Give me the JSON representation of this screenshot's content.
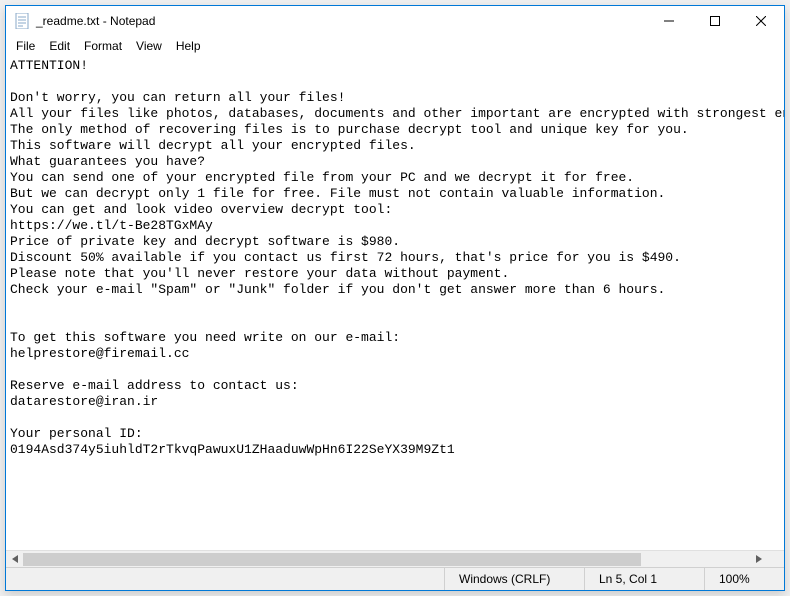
{
  "titlebar": {
    "title": "_readme.txt - Notepad"
  },
  "menubar": {
    "file": "File",
    "edit": "Edit",
    "format": "Format",
    "view": "View",
    "help": "Help"
  },
  "document": {
    "content": "ATTENTION!\n\nDon't worry, you can return all your files!\nAll your files like photos, databases, documents and other important are encrypted with strongest encryption and unique key.\nThe only method of recovering files is to purchase decrypt tool and unique key for you.\nThis software will decrypt all your encrypted files.\nWhat guarantees you have?\nYou can send one of your encrypted file from your PC and we decrypt it for free.\nBut we can decrypt only 1 file for free. File must not contain valuable information.\nYou can get and look video overview decrypt tool:\nhttps://we.tl/t-Be28TGxMAy\nPrice of private key and decrypt software is $980.\nDiscount 50% available if you contact us first 72 hours, that's price for you is $490.\nPlease note that you'll never restore your data without payment.\nCheck your e-mail \"Spam\" or \"Junk\" folder if you don't get answer more than 6 hours.\n\n\nTo get this software you need write on our e-mail:\nhelprestore@firemail.cc\n\nReserve e-mail address to contact us:\ndatarestore@iran.ir\n\nYour personal ID:\n0194Asd374y5iuhldT2rTkvqPawuxU1ZHaaduwWpHn6I22SeYX39M9Zt1"
  },
  "statusbar": {
    "line_ending": "Windows (CRLF)",
    "position": "Ln 5, Col 1",
    "zoom": "100%"
  }
}
